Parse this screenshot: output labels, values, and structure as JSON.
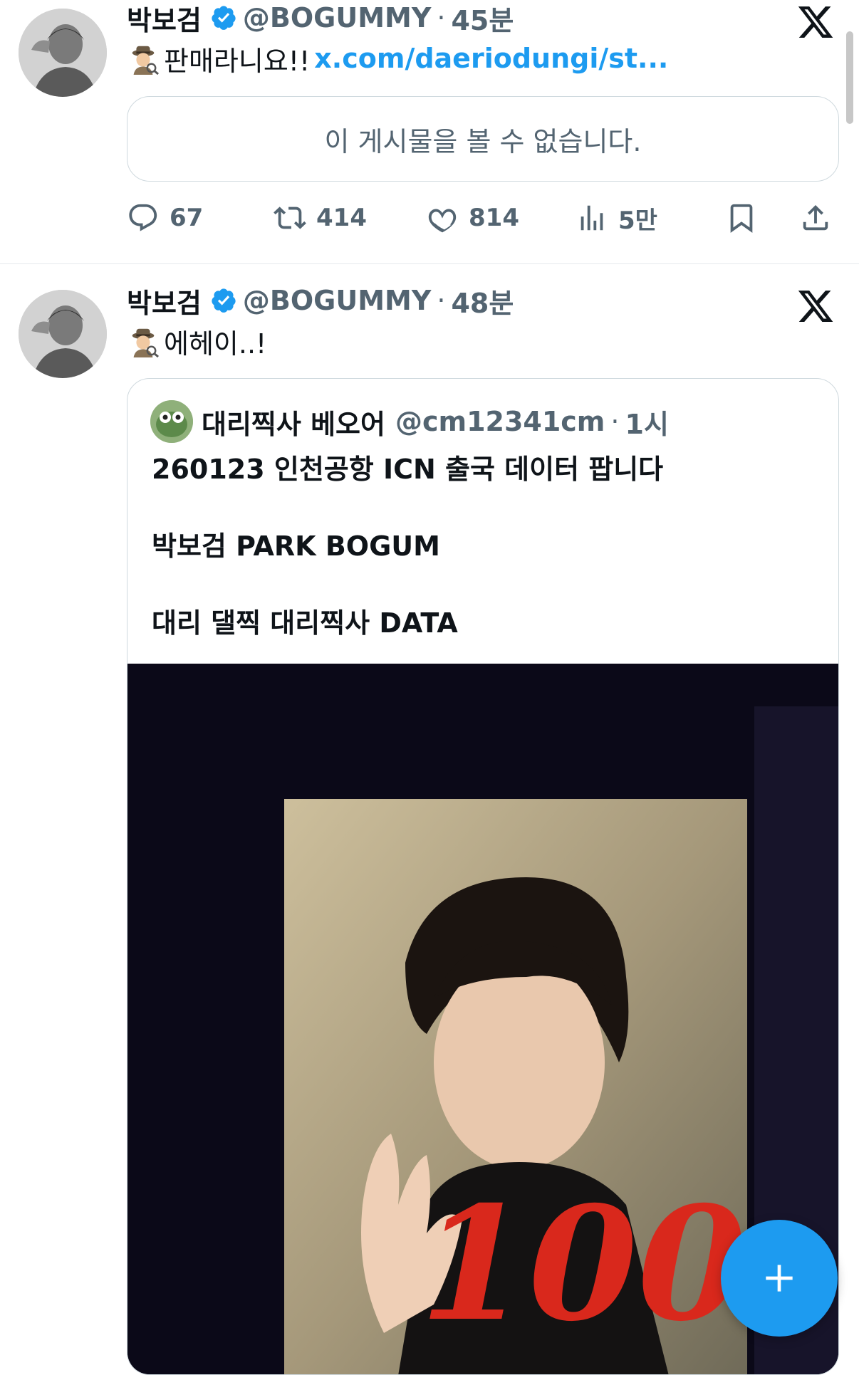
{
  "colors": {
    "accent": "#1d9bf0",
    "muted": "#536471",
    "text": "#0f1419",
    "border": "#cfd9de"
  },
  "tweets": [
    {
      "author_name": "박보검",
      "handle": "@BOGUMMY",
      "separator": "·",
      "time": "45분",
      "text": "판매라니요!!",
      "link": "x.com/daeriodungi/st...",
      "unavailable_text": "이 게시물을 볼 수 없습니다.",
      "replies": "67",
      "retweets": "414",
      "likes": "814",
      "views": "5만"
    },
    {
      "author_name": "박보검",
      "handle": "@BOGUMMY",
      "separator": "·",
      "time": "48분",
      "text": "에헤이..!",
      "quote": {
        "author_name": "대리찍사 베오어",
        "handle": "@cm12341cm",
        "separator": "·",
        "time": "1시",
        "line1": "260123 인천공항 ICN 출국 데이터 팝니다",
        "line2": "박보검 PARK BOGUM",
        "line3": "대리 댈찍 대리찍사  DATA"
      }
    }
  ],
  "icons": {
    "verified": "verified-badge-icon",
    "spy": "detective-emoji-icon",
    "x": "x-logo-icon",
    "reply": "reply-icon",
    "retweet": "retweet-icon",
    "like": "heart-icon",
    "views": "views-icon",
    "bookmark": "bookmark-icon",
    "share": "share-icon",
    "compose": "plus-icon"
  }
}
